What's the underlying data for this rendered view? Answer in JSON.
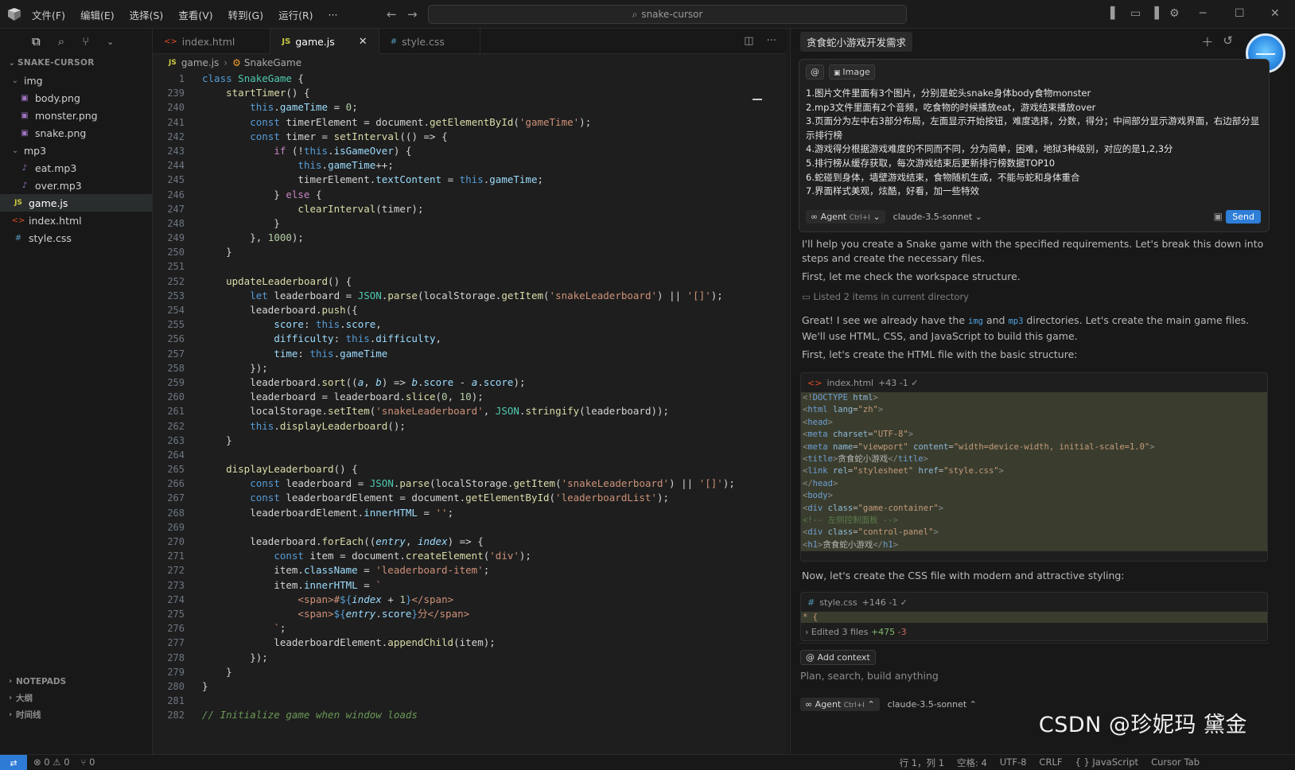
{
  "titlebar": {
    "menu": [
      "文件(F)",
      "编辑(E)",
      "选择(S)",
      "查看(V)",
      "转到(G)",
      "运行(R)",
      "···"
    ],
    "search": "snake-cursor"
  },
  "explorer": {
    "root": "SNAKE-CURSOR",
    "folders": [
      {
        "name": "img",
        "files": [
          "body.png",
          "monster.png",
          "snake.png"
        ]
      },
      {
        "name": "mp3",
        "files": [
          "eat.mp3",
          "over.mp3"
        ]
      }
    ],
    "root_files": [
      "game.js",
      "index.html",
      "style.css"
    ],
    "sections": [
      "NOTEPADS",
      "大纲",
      "时间线"
    ]
  },
  "editor": {
    "tabs": [
      {
        "label": "index.html",
        "icon": "html-icon"
      },
      {
        "label": "game.js",
        "icon": "js-icon",
        "active": true
      },
      {
        "label": "style.css",
        "icon": "css-icon"
      }
    ],
    "breadcrumb": {
      "file": "game.js",
      "symbol": "SnakeGame"
    },
    "line_numbers": [
      "1",
      "239",
      "240",
      "241",
      "242",
      "243",
      "244",
      "245",
      "246",
      "247",
      "248",
      "249",
      "250",
      "251",
      "252",
      "253",
      "254",
      "255",
      "256",
      "257",
      "258",
      "259",
      "260",
      "261",
      "262",
      "263",
      "264",
      "265",
      "266",
      "267",
      "268",
      "269",
      "270",
      "271",
      "272",
      "273",
      "274",
      "275",
      "276",
      "277",
      "278",
      "279",
      "280",
      "281",
      "282"
    ]
  },
  "chat": {
    "title": "贪食蛇小游戏开发需求",
    "chips": [
      "@",
      "Image"
    ],
    "requirements": [
      "1.图片文件里面有3个图片，分别是蛇头snake身体body食物monster",
      "2.mp3文件里面有2个音频，吃食物的时候播放eat，游戏结束播放over",
      "3.页面分为左中右3部分布局，左面显示开始按钮，难度选择，分数，得分；中间部分显示游戏界面，右边部分显示排行榜",
      "4.游戏得分根据游戏难度的不同而不同，分为简单，困难，地狱3种级别，对应的是1,2,3分",
      "5.排行榜从缓存获取，每次游戏结束后更新排行榜数据TOP10",
      "6.蛇碰到身体，墙壁游戏结束，食物随机生成，不能与蛇和身体重合",
      "7.界面样式美观，炫酷，好看，加一些特效"
    ],
    "agent_label": "Agent",
    "agent_shortcut": "Ctrl+I",
    "model": "claude-3.5-sonnet",
    "send": "Send",
    "msg1": "I'll help you create a Snake game with the specified requirements. Let's break this down into steps and create the necessary files.",
    "msg2": "First, let me check the workspace structure.",
    "listed": "Listed 2 items in current directory",
    "msg3_a": "Great! I see we already have the",
    "msg3_img": "img",
    "msg3_and": "and",
    "msg3_mp3": "mp3",
    "msg3_b": "directories. Let's create the main game files. We'll use HTML, CSS, and JavaScript to build this game.",
    "msg4": "First, let's create the HTML file with the basic structure:",
    "code1_file": "index.html",
    "code1_stats": "+43 -1 ✓",
    "msg5": "Now, let's create the CSS file with modern and attractive styling:",
    "code2_file": "style.css",
    "code2_stats": "+146 -1 ✓",
    "edited_label": "Edited 3 files",
    "edited_plus": "+475",
    "edited_minus": "-3",
    "add_context": "Add context",
    "placeholder": "Plan, search, build anything"
  },
  "statusbar": {
    "errors": "⊗ 0 ⚠ 0",
    "ports": "⑂ 0",
    "position": "行 1，列 1",
    "spaces": "空格: 4",
    "encoding": "UTF-8",
    "eol": "CRLF",
    "language": "{ } JavaScript",
    "cursor_tab": "Cursor Tab"
  },
  "watermark": "CSDN @珍妮玛 黛金"
}
